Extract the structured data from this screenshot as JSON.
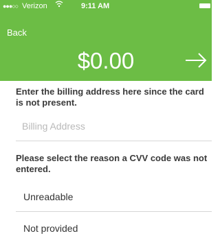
{
  "status_bar": {
    "carrier": "Verizon",
    "time": "9:11 AM"
  },
  "header": {
    "back_label": "Back",
    "amount": "$0.00"
  },
  "billing": {
    "prompt": "Enter the billing address here since the card is not present.",
    "input_value": "",
    "input_placeholder": "Billing Address"
  },
  "cvv": {
    "prompt": "Please select the reason a CVV code was not entered.",
    "options": [
      {
        "label": "Unreadable"
      },
      {
        "label": "Not provided"
      }
    ]
  },
  "colors": {
    "accent": "#6cbd45"
  }
}
